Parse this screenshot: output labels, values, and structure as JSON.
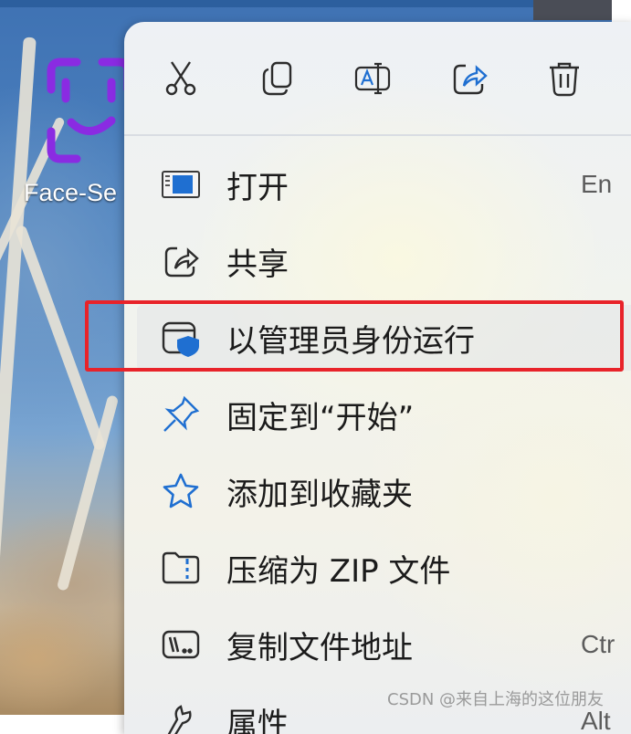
{
  "desktop": {
    "icon_label": "Face-Se"
  },
  "toolbar": {
    "buttons": [
      {
        "name": "cut",
        "icon": "scissors-icon"
      },
      {
        "name": "copy",
        "icon": "copy-icon"
      },
      {
        "name": "rename",
        "icon": "rename-icon"
      },
      {
        "name": "share",
        "icon": "share-icon"
      },
      {
        "name": "delete",
        "icon": "trash-icon"
      }
    ]
  },
  "menu": {
    "items": [
      {
        "label": "打开",
        "shortcut": "En",
        "icon": "open-window-icon"
      },
      {
        "label": "共享",
        "shortcut": "",
        "icon": "share-icon"
      },
      {
        "label": "以管理员身份运行",
        "shortcut": "",
        "icon": "shield-window-icon"
      },
      {
        "label": "固定到“开始”",
        "shortcut": "",
        "icon": "pin-icon"
      },
      {
        "label": "添加到收藏夹",
        "shortcut": "",
        "icon": "star-icon"
      },
      {
        "label": "压缩为 ZIP 文件",
        "shortcut": "",
        "icon": "zip-folder-icon"
      },
      {
        "label": "复制文件地址",
        "shortcut": "Ctr",
        "icon": "copy-path-icon"
      },
      {
        "label": "属性",
        "shortcut": "Alt",
        "icon": "properties-icon"
      }
    ]
  },
  "colors": {
    "accent": "#1f6fd1",
    "highlight_border": "#e8232a",
    "face_icon": "#8a2be2"
  },
  "watermark": "CSDN @来自上海的这位朋友"
}
